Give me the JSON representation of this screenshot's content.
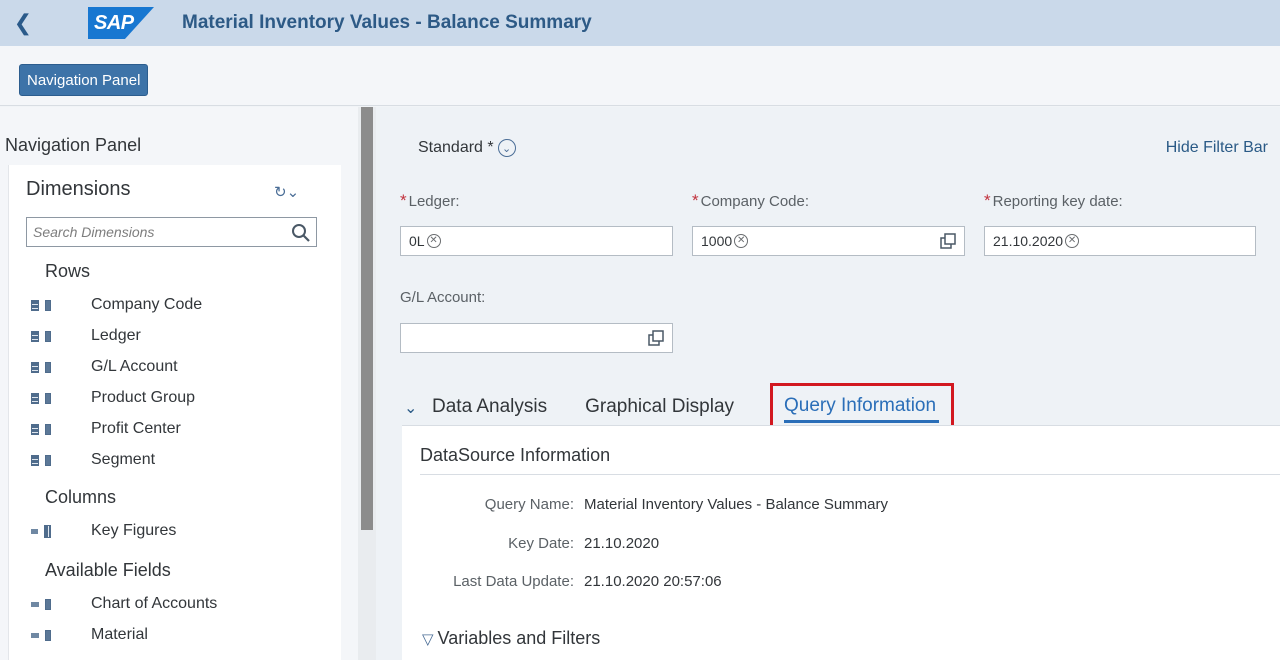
{
  "shell": {
    "title": "Material Inventory Values - Balance Summary",
    "logo_text": "SAP"
  },
  "toolbar": {
    "nav_button": "Navigation Panel"
  },
  "nav_panel": {
    "title": "Navigation Panel",
    "dimensions_title": "Dimensions",
    "search_placeholder": "Search Dimensions",
    "rows_title": "Rows",
    "rows": [
      "Company Code",
      "Ledger",
      "G/L Account",
      "Product Group",
      "Profit Center",
      "Segment"
    ],
    "columns_title": "Columns",
    "columns": [
      "Key Figures"
    ],
    "available_title": "Available Fields",
    "available": [
      "Chart of Accounts",
      "Material"
    ]
  },
  "filter_bar": {
    "variant": "Standard *",
    "hide_filter_bar": "Hide Filter Bar",
    "required_mark": "*",
    "ledger_label": "Ledger:",
    "ledger_value": "0L",
    "company_code_label": "Company Code:",
    "company_code_value": "1000",
    "key_date_label": "Reporting key date:",
    "key_date_value": "21.10.2020",
    "gl_account_label": "G/L Account:",
    "gl_account_value": ""
  },
  "tabs": {
    "data_analysis": "Data Analysis",
    "graphical_display": "Graphical Display",
    "query_information": "Query Information"
  },
  "query_info": {
    "datasource_title": "DataSource Information",
    "query_name_label": "Query Name:",
    "query_name_value": "Material Inventory Values - Balance Summary",
    "key_date_label": "Key Date:",
    "key_date_value": "21.10.2020",
    "last_update_label": "Last Data Update:",
    "last_update_value": "21.10.2020 20:57:06",
    "variables_title": "Variables and Filters"
  },
  "colors": {
    "shell_bg": "#cad9ea",
    "brand": "#1777d1",
    "highlight": "#d21820",
    "active_tab": "#2a6eb8"
  }
}
